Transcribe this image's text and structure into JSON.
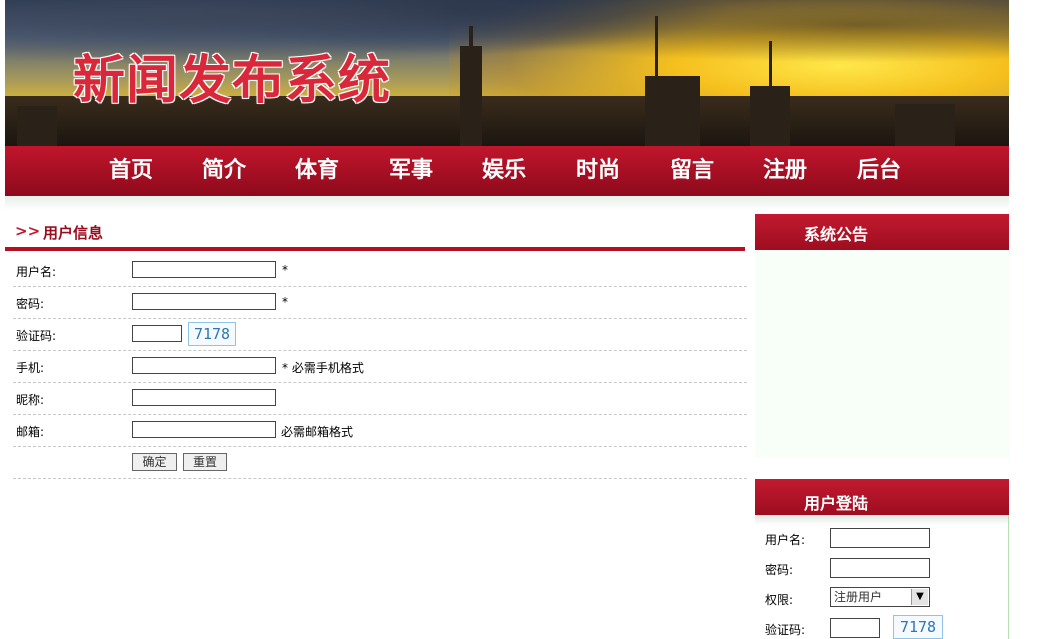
{
  "header": {
    "site_title": "新闻发布系统"
  },
  "nav": {
    "items": [
      "首页",
      "简介",
      "体育",
      "军事",
      "娱乐",
      "时尚",
      "留言",
      "注册",
      "后台"
    ]
  },
  "register": {
    "heading_arrows": ">>",
    "heading": "用户信息",
    "fields": {
      "username": {
        "label": "用户名:",
        "value": "",
        "note": "*"
      },
      "password": {
        "label": "密码:",
        "value": "",
        "note": "*"
      },
      "captcha": {
        "label": "验证码:",
        "value": "",
        "code": "7178"
      },
      "phone": {
        "label": "手机:",
        "value": "",
        "note": "* 必需手机格式"
      },
      "nickname": {
        "label": "昵称:",
        "value": ""
      },
      "email": {
        "label": "邮箱:",
        "value": "",
        "note": "必需邮箱格式"
      }
    },
    "submit_label": "确定",
    "reset_label": "重置"
  },
  "sidebar": {
    "notice_title": "系统公告",
    "login": {
      "title": "用户登陆",
      "username_label": "用户名:",
      "password_label": "密码:",
      "role_label": "权限:",
      "role_selected": "注册用户",
      "captcha_label": "验证码:",
      "captcha_code": "7178"
    }
  },
  "colors": {
    "brand_red": "#b5101f",
    "nav_text": "#ffffff",
    "captcha_blue": "#2e76b6"
  }
}
